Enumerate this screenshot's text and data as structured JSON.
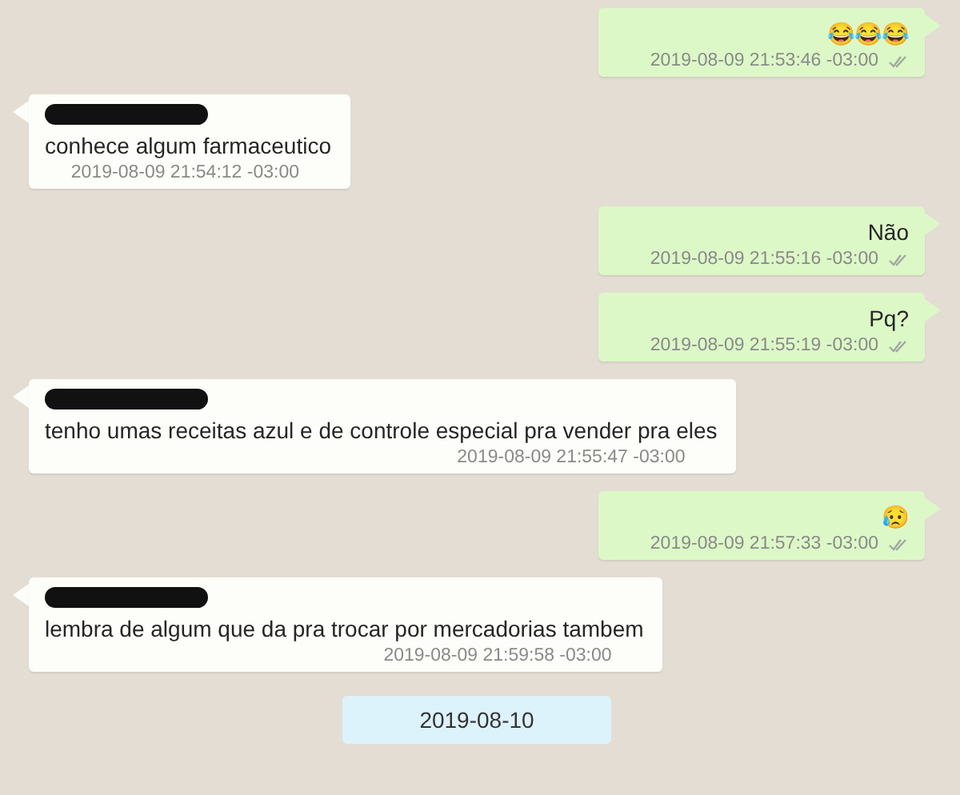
{
  "messages": [
    {
      "kind": "outgoing",
      "text": "😂😂😂",
      "time": "2019-08-09 21:53:46 -03:00",
      "read": false
    },
    {
      "kind": "incoming",
      "sender_redacted": true,
      "text": "conhece algum farmaceutico",
      "time": "2019-08-09 21:54:12 -03:00"
    },
    {
      "kind": "outgoing",
      "text": "Não",
      "time": "2019-08-09 21:55:16 -03:00",
      "read": false
    },
    {
      "kind": "outgoing",
      "text": "Pq?",
      "time": "2019-08-09 21:55:19 -03:00",
      "read": false
    },
    {
      "kind": "incoming",
      "sender_redacted": true,
      "text": "tenho umas receitas azul e de controle especial pra vender pra eles",
      "time": "2019-08-09 21:55:47 -03:00"
    },
    {
      "kind": "outgoing",
      "text": "😥",
      "time": "2019-08-09 21:57:33 -03:00",
      "read": false
    },
    {
      "kind": "incoming",
      "sender_redacted": true,
      "text": "lembra de algum que da pra trocar por mercadorias tambem",
      "time": "2019-08-09 21:59:58 -03:00"
    },
    {
      "kind": "date",
      "text": "2019-08-10"
    }
  ]
}
